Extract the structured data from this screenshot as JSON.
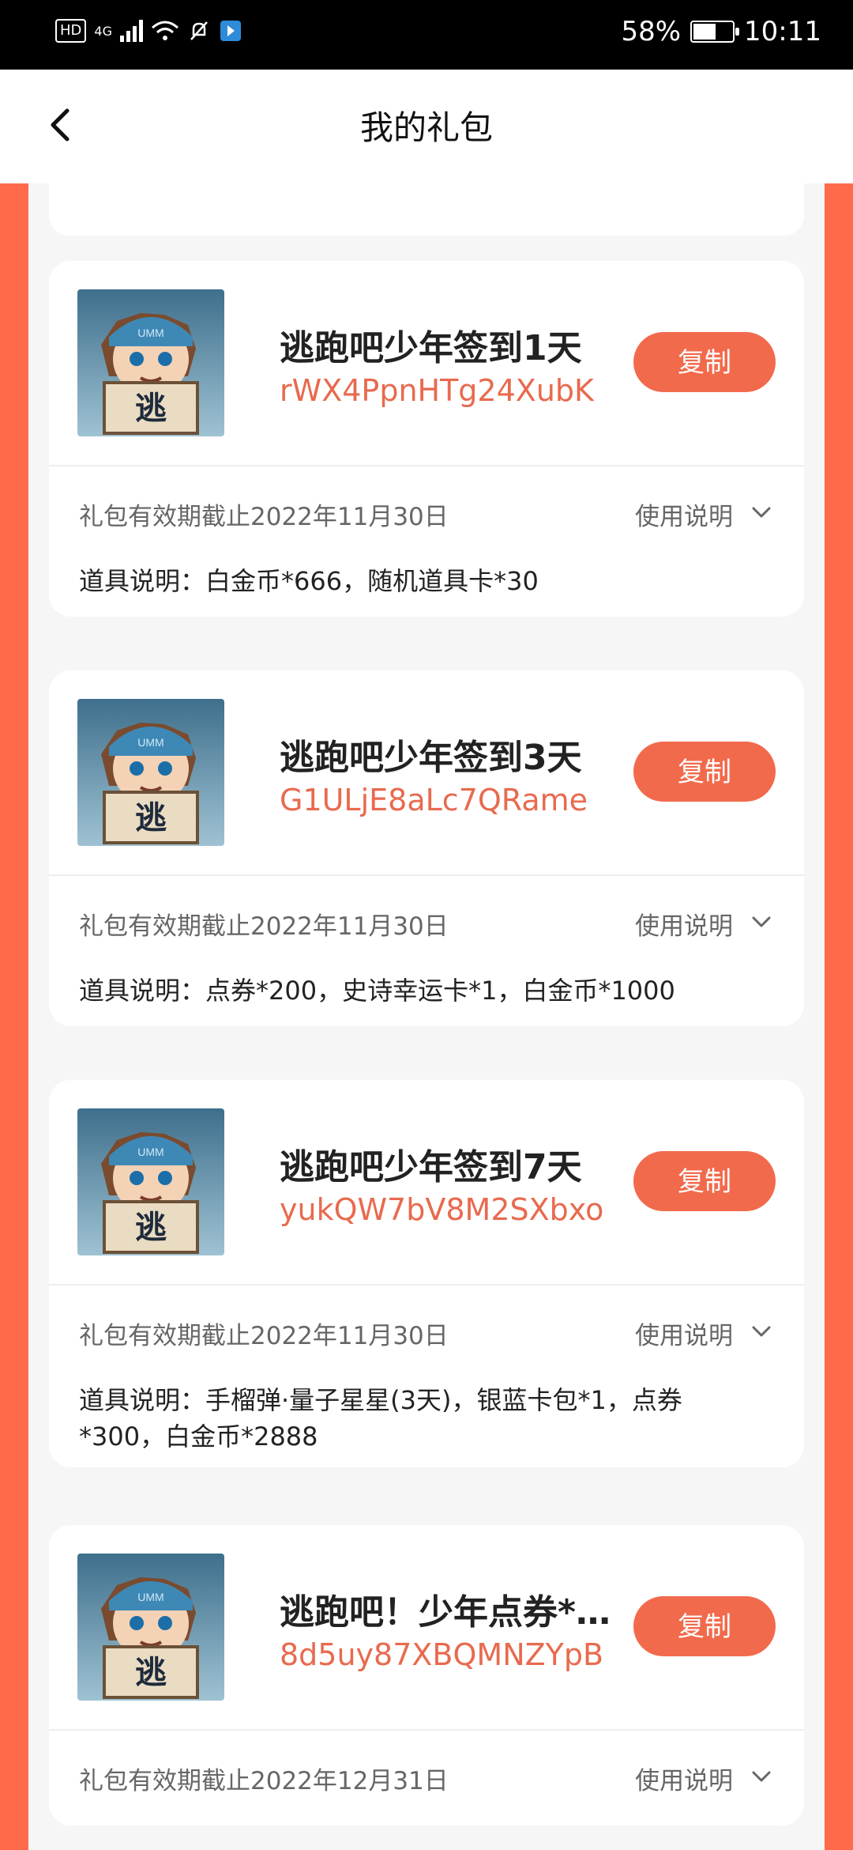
{
  "status_bar": {
    "left_icons": [
      "hd-badge",
      "signal-4g",
      "wifi-icon",
      "mute-bell-icon",
      "app-icon"
    ],
    "hd_label": "HD",
    "network_label": "4G",
    "battery_percent_text": "58%",
    "battery_level": 0.58,
    "time": "10:11"
  },
  "header": {
    "title": "我的礼包",
    "back_icon": "chevron-left-icon"
  },
  "gifts": [
    {
      "title": "逃跑吧少年签到1天",
      "code": "rWX4PpnHTg24XubK",
      "copy_label": "复制",
      "expire": "礼包有效期截止2022年11月30日",
      "usage_label": "使用说明",
      "desc": "道具说明：白金币*666，随机道具卡*30"
    },
    {
      "title": "逃跑吧少年签到3天",
      "code": "G1ULjE8aLc7QRame",
      "copy_label": "复制",
      "expire": "礼包有效期截止2022年11月30日",
      "usage_label": "使用说明",
      "desc": "道具说明：点券*200，史诗幸运卡*1，白金币*1000"
    },
    {
      "title": "逃跑吧少年签到7天",
      "code": "yukQW7bV8M2SXbxo",
      "copy_label": "复制",
      "expire": "礼包有效期截止2022年11月30日",
      "usage_label": "使用说明",
      "desc": "道具说明：手榴弹·量子星星(3天)，银蓝卡包*1，点券*300，白金币*2888"
    },
    {
      "title": "逃跑吧！少年点券*…",
      "code": "8d5uy87XBQMNZYpB",
      "copy_label": "复制",
      "expire": "礼包有效期截止2022年12月31日",
      "usage_label": "使用说明",
      "desc": ""
    }
  ],
  "colors": {
    "accent": "#f26a4c",
    "background_frame": "#ff6b4a",
    "code_text": "#e86a4e"
  }
}
